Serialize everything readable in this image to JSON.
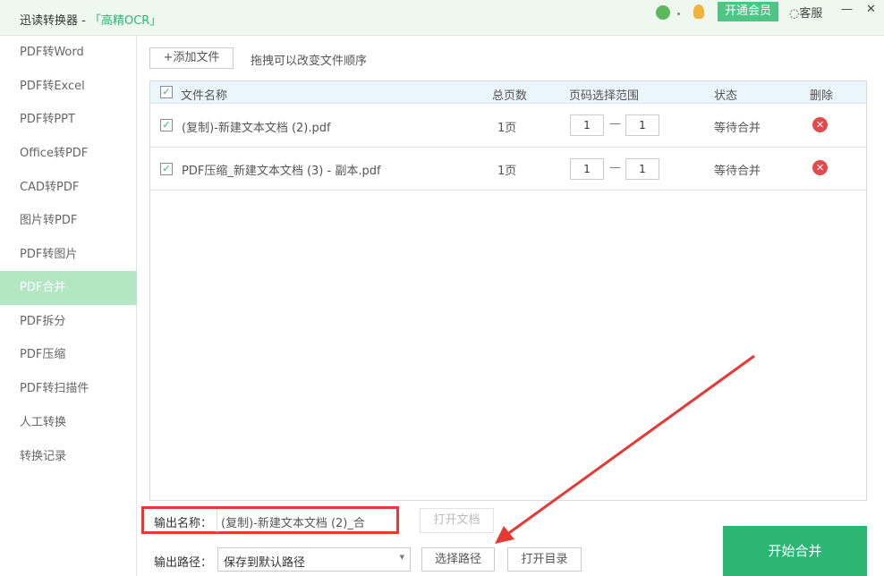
{
  "title": {
    "app": "迅读转换器 - ",
    "ocr": "「高精OCR」",
    "vip": "开通会员",
    "service": "客服",
    "minimize": "—",
    "close": "✕"
  },
  "sidebar": {
    "items": [
      {
        "label": "PDF转Word"
      },
      {
        "label": "PDF转Excel"
      },
      {
        "label": "PDF转PPT"
      },
      {
        "label": "Office转PDF"
      },
      {
        "label": "CAD转PDF"
      },
      {
        "label": "图片转PDF"
      },
      {
        "label": "PDF转图片"
      },
      {
        "label": "PDF合并",
        "active": true
      },
      {
        "label": "PDF拆分"
      },
      {
        "label": "PDF压缩"
      },
      {
        "label": "PDF转扫描件"
      },
      {
        "label": "人工转换"
      },
      {
        "label": "转换记录"
      }
    ]
  },
  "toolbar": {
    "add_file": "+添加文件",
    "hint": "拖拽可以改变文件顺序"
  },
  "table": {
    "headers": {
      "name": "文件名称",
      "pages": "总页数",
      "range": "页码选择范围",
      "status": "状态",
      "delete": "删除"
    },
    "rows": [
      {
        "name": "(复制)-新建文本文档 (2).pdf",
        "pages": "1页",
        "from": "1",
        "to": "1",
        "status": "等待合并"
      },
      {
        "name": "PDF压缩_新建文本文档 (3) - 副本.pdf",
        "pages": "1页",
        "from": "1",
        "to": "1",
        "status": "等待合并"
      }
    ]
  },
  "output": {
    "name_label": "输出名称：",
    "name_value": "(复制)-新建文本文档 (2)_合",
    "open_doc": "打开文档",
    "path_label": "输出路径：",
    "path_value": "保存到默认路径",
    "choose_path": "选择路径",
    "open_dir": "打开目录",
    "start": "开始合并"
  },
  "colors": {
    "accent": "#2bb673",
    "highlight": "#e53935"
  }
}
